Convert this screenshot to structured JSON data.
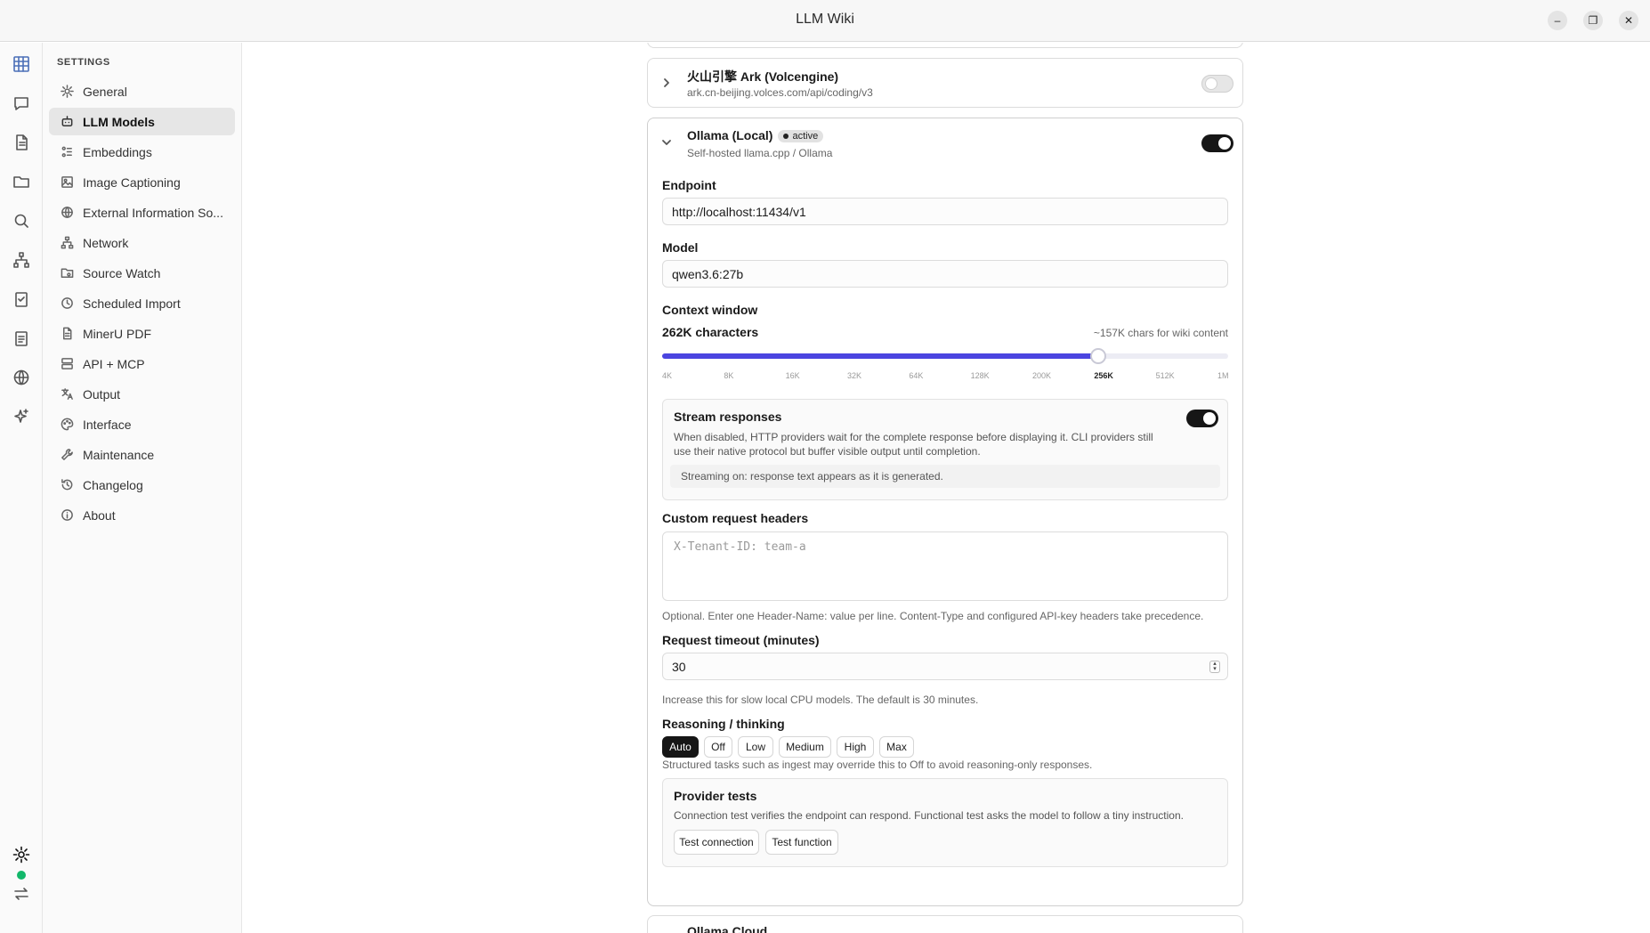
{
  "window": {
    "title": "LLM Wiki",
    "minimize_glyph": "–",
    "maximize_glyph": "❐",
    "close_glyph": "✕"
  },
  "rail": {
    "icons": [
      "app-grid-icon",
      "chat-icon",
      "document-icon",
      "folder-icon",
      "search-icon",
      "graph-icon",
      "clipboard-check-icon",
      "clipboard-list-icon",
      "globe-icon",
      "sparkle-icon",
      "settings-icon",
      "swap-icon"
    ],
    "status_color": "#12b76a"
  },
  "sidebar": {
    "heading": "SETTINGS",
    "items": [
      {
        "label": "General",
        "icon": "gear-icon"
      },
      {
        "label": "LLM Models",
        "icon": "robot-icon",
        "active": true
      },
      {
        "label": "Embeddings",
        "icon": "embedding-icon"
      },
      {
        "label": "Image Captioning",
        "icon": "image-icon"
      },
      {
        "label": "External Information So...",
        "icon": "globe-icon"
      },
      {
        "label": "Network",
        "icon": "network-icon"
      },
      {
        "label": "Source Watch",
        "icon": "folder-watch-icon"
      },
      {
        "label": "Scheduled Import",
        "icon": "clock-icon"
      },
      {
        "label": "MinerU PDF",
        "icon": "file-icon"
      },
      {
        "label": "API + MCP",
        "icon": "server-icon"
      },
      {
        "label": "Output",
        "icon": "translate-icon"
      },
      {
        "label": "Interface",
        "icon": "palette-icon"
      },
      {
        "label": "Maintenance",
        "icon": "wrench-icon"
      },
      {
        "label": "Changelog",
        "icon": "history-icon"
      },
      {
        "label": "About",
        "icon": "info-icon"
      }
    ]
  },
  "providers": {
    "ark": {
      "name": "火山引擎 Ark (Volcengine)",
      "endpoint": "ark.cn-beijing.volces.com/api/coding/v3",
      "enabled": false
    },
    "ollama": {
      "name": "Ollama (Local)",
      "badge": "active",
      "subtitle": "Self-hosted llama.cpp / Ollama",
      "enabled": true,
      "endpoint_label": "Endpoint",
      "endpoint_value": "http://localhost:11434/v1",
      "model_label": "Model",
      "model_value": "qwen3.6:27b",
      "context_label": "Context window",
      "context_value": "262K characters",
      "context_hint": "~157K chars for wiki content",
      "context_ticks": [
        "4K",
        "8K",
        "16K",
        "32K",
        "64K",
        "128K",
        "200K",
        "256K",
        "512K",
        "1M"
      ],
      "context_selected": "256K",
      "context_fraction": 0.77,
      "stream_title": "Stream responses",
      "stream_desc": "When disabled, HTTP providers wait for the complete response before displaying it. CLI providers still use their native protocol but buffer visible output until completion.",
      "stream_note": "Streaming on: response text appears as it is generated.",
      "stream_enabled": true,
      "headers_label": "Custom request headers",
      "headers_placeholder": "X-Tenant-ID: team-a",
      "headers_hint": "Optional. Enter one Header-Name: value per line. Content-Type and configured API-key headers take precedence.",
      "timeout_label": "Request timeout (minutes)",
      "timeout_value": "30",
      "timeout_hint": "Increase this for slow local CPU models. The default is 30 minutes.",
      "reasoning_label": "Reasoning / thinking",
      "reasoning_options": [
        "Auto",
        "Off",
        "Low",
        "Medium",
        "High",
        "Max"
      ],
      "reasoning_selected": "Auto",
      "reasoning_hint": "Structured tasks such as ingest may override this to Off to avoid reasoning-only responses.",
      "tests_title": "Provider tests",
      "tests_desc": "Connection test verifies the endpoint can respond. Functional test asks the model to follow a tiny instruction.",
      "test_connection": "Test connection",
      "test_function": "Test function"
    },
    "ollama_cloud": {
      "name": "Ollama Cloud"
    }
  },
  "colors": {
    "accent": "#4b45e0",
    "toggle_on": "#161616"
  }
}
